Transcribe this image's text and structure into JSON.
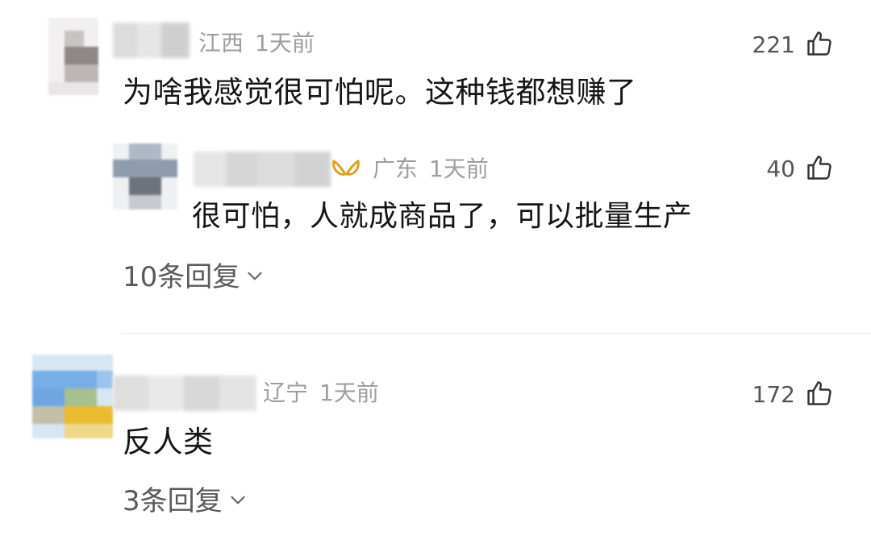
{
  "comments": [
    {
      "region": "江西",
      "time": "1天前",
      "likes": "221",
      "text": "为啥我感觉很可怕呢。这种钱都想赚了",
      "reply": {
        "region": "广东",
        "time": "1天前",
        "likes": "40",
        "text": "很可怕，人就成商品了，可以批量生产"
      },
      "replies_label": "10条回复"
    },
    {
      "region": "辽宁",
      "time": "1天前",
      "likes": "172",
      "text": "反人类",
      "replies_label": "3条回复"
    }
  ],
  "icons": {
    "like": "thumbs-up-icon",
    "expand": "chevron-down-icon",
    "badge": "ribbon-badge-icon"
  },
  "colors": {
    "meta_text": "#9e9e9e",
    "body_text": "#151515",
    "badge": "#e0a020"
  }
}
